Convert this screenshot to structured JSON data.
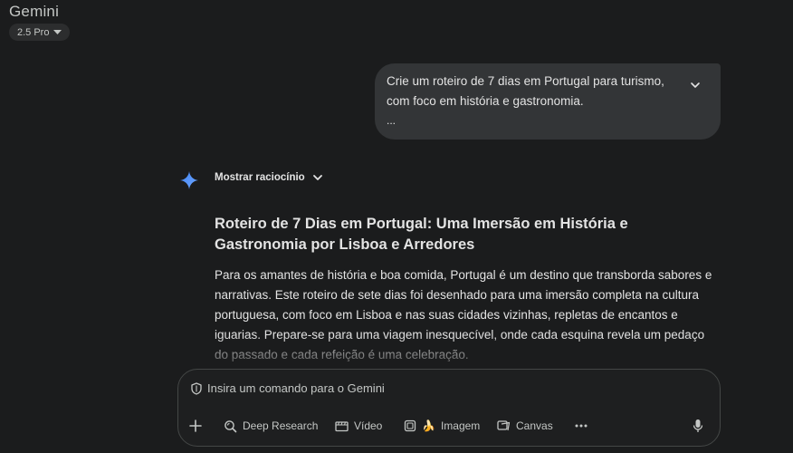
{
  "header": {
    "app_title": "Gemini",
    "model_label": "2.5 Pro"
  },
  "conversation": {
    "user_message": {
      "text": "Crie um roteiro de 7 dias em Portugal para turismo, com foco em história e gastronomia.",
      "ellipsis": "..."
    },
    "response": {
      "reasoning_label": "Mostrar raciocínio",
      "title": "Roteiro de 7 Dias em Portugal: Uma Imersão em História e Gastronomia por Lisboa e Arredores",
      "body": "Para os amantes de história e boa comida, Portugal é um destino que transborda sabores e narrativas. Este roteiro de sete dias foi desenhado para uma imersão completa na cultura portuguesa, com foco em Lisboa e nas suas cidades vizinhas, repletas de encantos e iguarias. Prepare-se para uma viagem inesquecível, onde cada esquina revela um pedaço do passado e cada refeição é uma celebração."
    }
  },
  "composer": {
    "placeholder": "Insira um comando para o Gemini",
    "tools": {
      "deep_research": "Deep Research",
      "video": "Vídeo",
      "image": "Imagem",
      "canvas": "Canvas"
    }
  },
  "colors": {
    "background": "#1b1c1d",
    "user_bubble": "#333537",
    "gemini_blue": "#4285f4"
  }
}
